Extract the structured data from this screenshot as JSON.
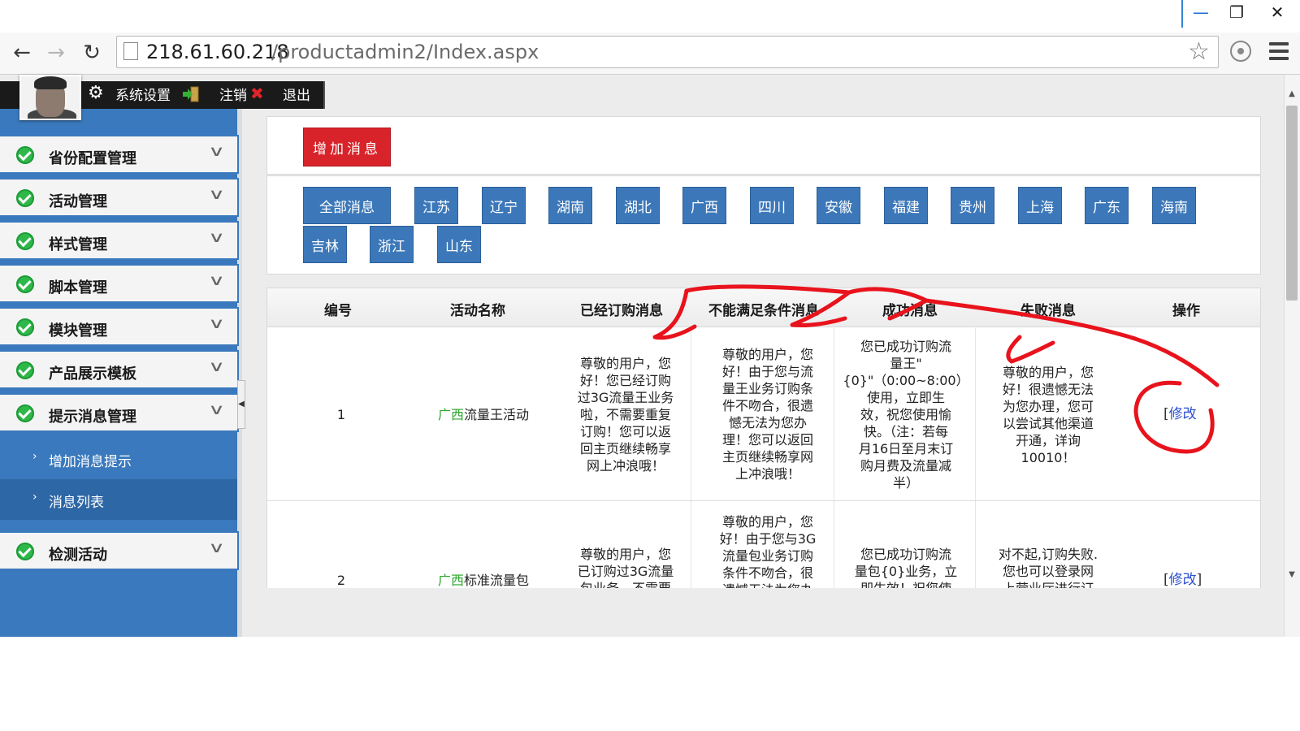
{
  "browser": {
    "url_host": "218.61.60.218",
    "url_path": "/productadmin2/Index.aspx"
  },
  "userbar": {
    "settings": "系统设置",
    "logout": "注销",
    "exit": "退出"
  },
  "sidebar": {
    "items": [
      {
        "label": "省份配置管理"
      },
      {
        "label": "活动管理"
      },
      {
        "label": "样式管理"
      },
      {
        "label": "脚本管理"
      },
      {
        "label": "模块管理"
      },
      {
        "label": "产品展示模板"
      },
      {
        "label": "提示消息管理"
      },
      {
        "label": "检测活动"
      }
    ],
    "sub_items": [
      {
        "label": "增加消息提示"
      },
      {
        "label": "消息列表"
      }
    ]
  },
  "main": {
    "add_button": "增加消息",
    "filters": [
      "全部消息",
      "江苏",
      "辽宁",
      "湖南",
      "湖北",
      "广西",
      "四川",
      "安徽",
      "福建",
      "贵州",
      "上海",
      "广东",
      "海南",
      "吉林",
      "浙江",
      "山东"
    ],
    "table": {
      "headers": [
        "编号",
        "活动名称",
        "已经订购消息",
        "不能满足条件消息",
        "成功消息",
        "失败消息",
        "操作"
      ],
      "rows": [
        {
          "id": "1",
          "name_prefix": "广西",
          "name_suffix": "流量王活动",
          "ordered": [
            "尊敬的用户，您",
            "好！您已经订购",
            "过3G流量王业务",
            "啦，不需要重复",
            "订购！您可以返",
            "回主页继续畅享",
            "网上冲浪哦！"
          ],
          "unmet": [
            "尊敬的用户，您",
            "好！由于您与流",
            "量王业务订购条",
            "件不吻合，很遗",
            "憾无法为您办",
            "理！您可以返回",
            "主页继续畅享网",
            "上冲浪哦！"
          ],
          "success": [
            "您已成功订购流",
            "量王\"",
            "{0}\"（0:00~8:00）",
            "使用，立即生",
            "效，祝您使用愉",
            "快。（注：若每",
            "月16日至月末订",
            "购月费及流量减",
            "半）"
          ],
          "fail": [
            "尊敬的用户，您",
            "好！很遗憾无法",
            "为您办理，您可",
            "以尝试其他渠道",
            "开通，详询",
            "10010！"
          ],
          "action_left": "[",
          "action": "修改"
        },
        {
          "id": "2",
          "name_prefix": "广西",
          "name_suffix": "标准流量包",
          "ordered": [
            "尊敬的用户，您",
            "已订购过3G流量",
            "包业务，不需要"
          ],
          "unmet": [
            "尊敬的用户，您",
            "好！由于您与3G",
            "流量包业务订购",
            "条件不吻合，很",
            "遗憾无法为您办"
          ],
          "success": [
            "您已成功订购流",
            "量包{0}业务，立",
            "即生效！祝您使"
          ],
          "fail": [
            "对不起,订购失败.",
            "您也可以登录网",
            "上营业厅进行订"
          ],
          "action_left": "[",
          "action": "修改",
          "action_right": "]"
        }
      ]
    }
  },
  "colors": {
    "sidebar_blue": "#3a79bd",
    "accent_red": "#d8232a",
    "check_green": "#2eb84a",
    "annotation_red": "#e8131c"
  }
}
